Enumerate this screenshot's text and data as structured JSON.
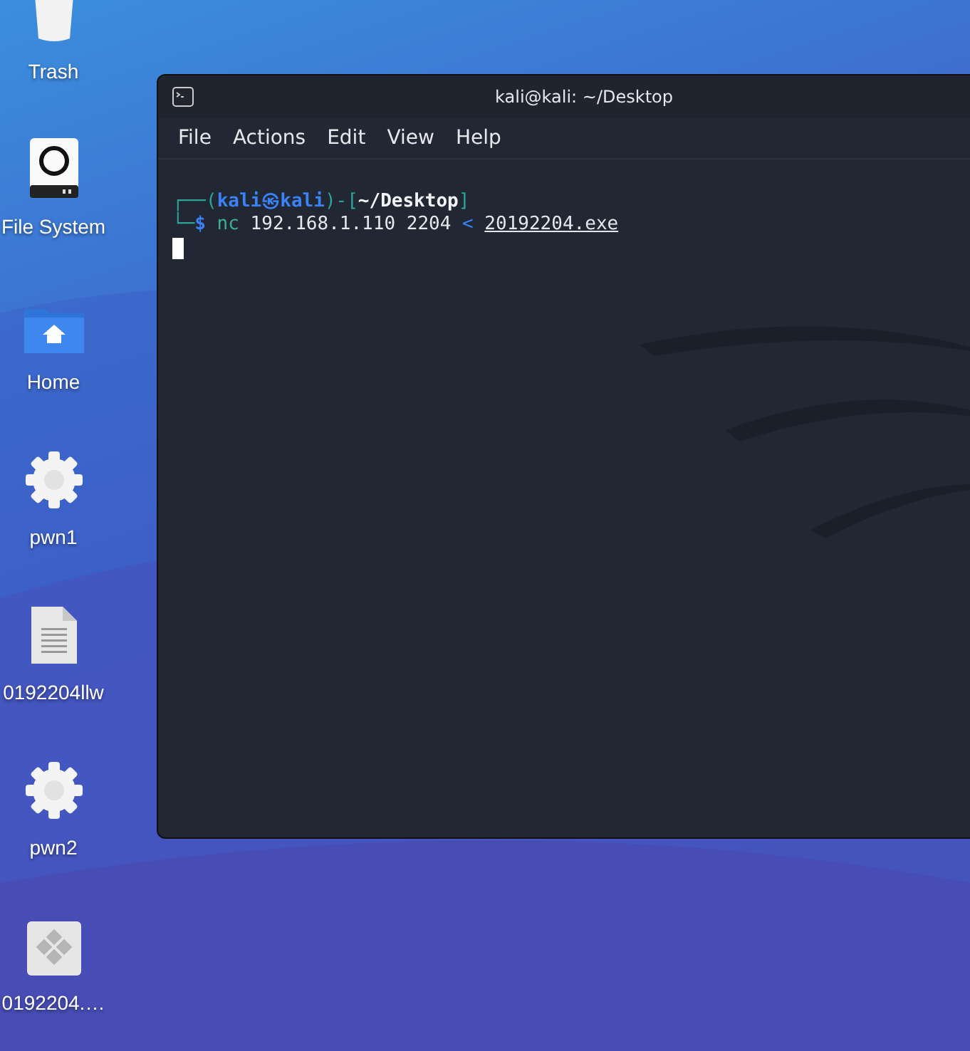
{
  "desktop_icons": [
    {
      "label": "Trash",
      "kind": "trash"
    },
    {
      "label": "File System",
      "kind": "disk"
    },
    {
      "label": "Home",
      "kind": "home"
    },
    {
      "label": "pwn1",
      "kind": "gear"
    },
    {
      "label": "0192204llw",
      "kind": "document"
    },
    {
      "label": "pwn2",
      "kind": "gear"
    },
    {
      "label": "0192204.…",
      "kind": "app"
    }
  ],
  "window": {
    "title": "kali@kali: ~/Desktop"
  },
  "menu": [
    "File",
    "Actions",
    "Edit",
    "View",
    "Help"
  ],
  "terminal": {
    "lines": [
      [
        {
          "text": "┌──(",
          "kind": "frame"
        },
        {
          "text": "kali㉿kali",
          "kind": "user"
        },
        {
          "text": ")-[",
          "kind": "frame"
        },
        {
          "text": "~/Desktop",
          "kind": "dir"
        },
        {
          "text": "]",
          "kind": "frame"
        }
      ],
      [
        {
          "text": "└─",
          "kind": "frame"
        },
        {
          "text": "$",
          "kind": "user"
        },
        {
          "text": " nc",
          "kind": "command"
        },
        {
          "text": " 192.168.1.110 2204 ",
          "kind": "plain"
        },
        {
          "text": "< ",
          "kind": "operator"
        },
        {
          "text": "20192204.exe",
          "kind": "path"
        }
      ]
    ],
    "cursor": true
  }
}
